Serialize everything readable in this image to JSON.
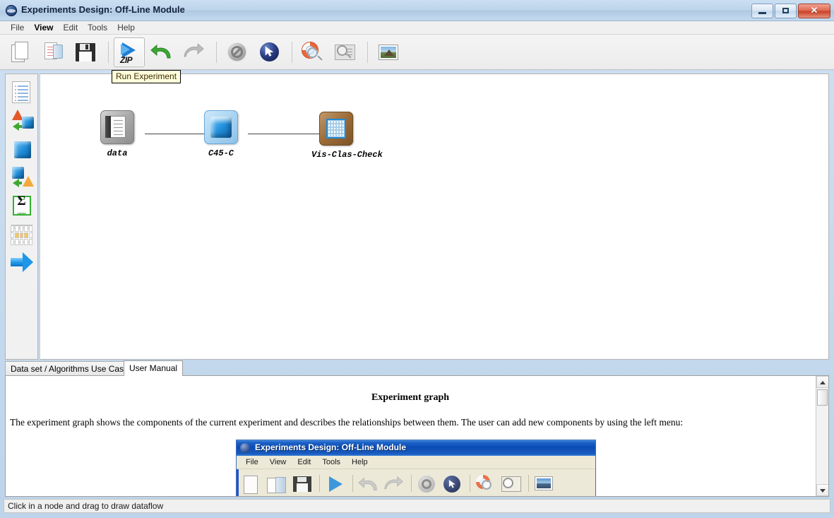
{
  "window": {
    "title": "Experiments Design: Off-Line Module",
    "app_icon": "globe-icon",
    "minimize_label": "–",
    "maximize_label": "□",
    "close_label": "✕"
  },
  "menubar": {
    "items": [
      {
        "label": "File"
      },
      {
        "label": "View"
      },
      {
        "label": "Edit"
      },
      {
        "label": "Tools"
      },
      {
        "label": "Help"
      }
    ]
  },
  "toolbar": {
    "buttons": [
      {
        "name": "new-experiment",
        "icon": "new-document-icon"
      },
      {
        "name": "open-experiment",
        "icon": "open-folder-icon"
      },
      {
        "name": "save-experiment",
        "icon": "floppy-disk-icon"
      },
      {
        "name": "run-experiment",
        "icon": "zip-play-icon",
        "label": "ZIP"
      },
      {
        "name": "undo",
        "icon": "undo-arrow-icon"
      },
      {
        "name": "redo",
        "icon": "redo-arrow-icon"
      },
      {
        "name": "stop",
        "icon": "no-entry-icon"
      },
      {
        "name": "select-pointer",
        "icon": "cursor-arrow-icon"
      },
      {
        "name": "help-search",
        "icon": "lifesaver-magnifier-icon"
      },
      {
        "name": "zoom-window",
        "icon": "zoom-window-icon"
      },
      {
        "name": "view-image",
        "icon": "landscape-image-icon"
      }
    ]
  },
  "tooltip": {
    "text": "Run Experiment"
  },
  "palette": {
    "items": [
      {
        "name": "dataset",
        "icon": "dataset-sheet-icon"
      },
      {
        "name": "preprocessing",
        "icon": "cone-to-cube-icon"
      },
      {
        "name": "algorithm",
        "icon": "blue-cube-icon"
      },
      {
        "name": "postprocessing",
        "icon": "cube-to-cone-icon"
      },
      {
        "name": "statistics",
        "icon": "green-sigma-icon"
      },
      {
        "name": "visualization",
        "icon": "table-grid-icon"
      },
      {
        "name": "dataflow-arrow",
        "icon": "blue-arrow-icon"
      }
    ]
  },
  "graph": {
    "nodes": [
      {
        "id": "data",
        "label": "data",
        "icon": "data-document-node-icon"
      },
      {
        "id": "c45c",
        "label": "C45-C",
        "icon": "blue-cube-node-icon"
      },
      {
        "id": "visclascheck",
        "label": "Vis-Clas-Check",
        "icon": "table-node-icon"
      }
    ],
    "edges": [
      {
        "from": "data",
        "to": "c45c"
      },
      {
        "from": "c45c",
        "to": "visclascheck"
      }
    ]
  },
  "tabs": [
    {
      "label": "Data set / Algorithms Use Case",
      "active": false
    },
    {
      "label": "User Manual",
      "active": true
    }
  ],
  "manual": {
    "heading": "Experiment graph",
    "paragraph": "The experiment graph shows the components of the current experiment and describes the relationships between them. The user can add new components by using the left menu:",
    "embedded_screenshot": {
      "title": "Experiments Design: Off-Line Module",
      "menu": [
        "File",
        "View",
        "Edit",
        "Tools",
        "Help"
      ]
    }
  },
  "statusbar": {
    "message": "Click in a node and drag to draw dataflow"
  },
  "colors": {
    "titlebar": "#bdd4ea",
    "accent_blue": "#1f8ad6",
    "node_brown": "#9a6b38",
    "tooltip_bg": "#ffffdd",
    "close_red": "#c94127"
  }
}
